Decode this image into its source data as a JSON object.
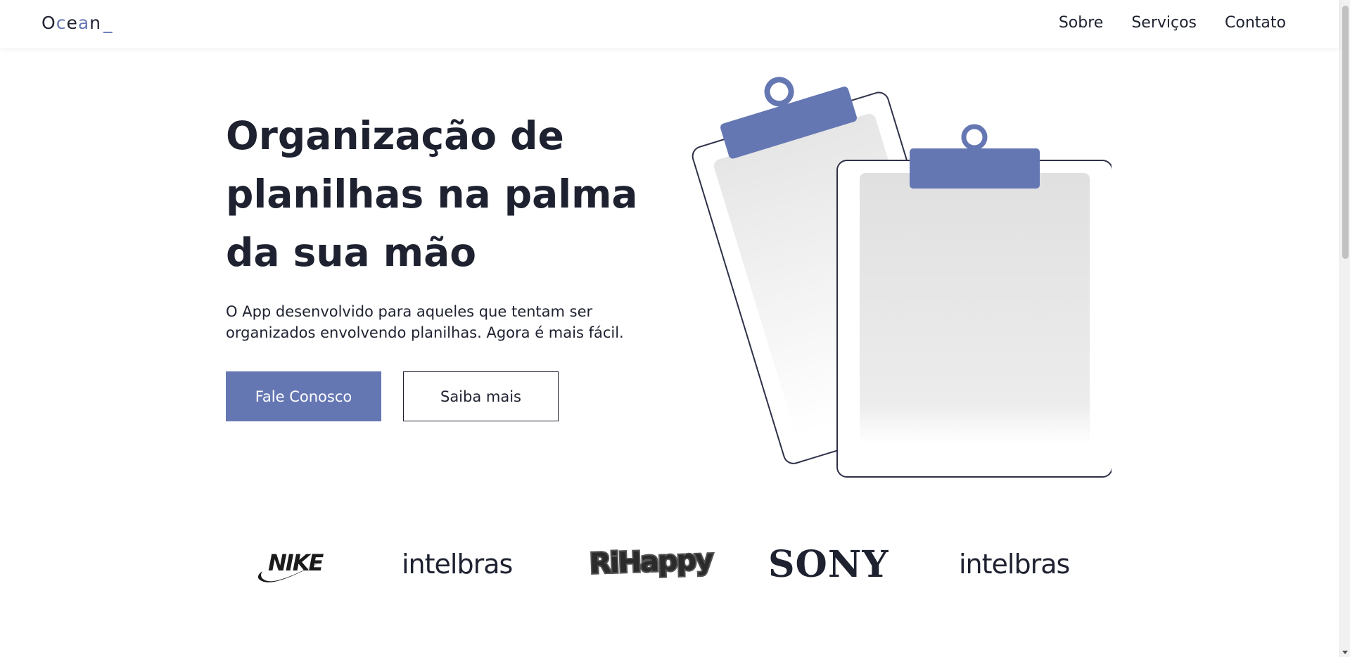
{
  "header": {
    "logo": {
      "part1": "O",
      "part2": "c",
      "part3": "e",
      "part4": "a",
      "part5": "n",
      "cursor": "_"
    },
    "nav": [
      {
        "label": "Sobre"
      },
      {
        "label": "Serviços"
      },
      {
        "label": "Contato"
      }
    ]
  },
  "hero": {
    "title": "Organização de planilhas na palma da sua mão",
    "description": "O App desenvolvido para aqueles que tentam ser organizados envolvendo planilhas. Agora é mais fácil.",
    "primary_button": "Fale Conosco",
    "secondary_button": "Saiba mais"
  },
  "brands": [
    {
      "name": "NIKE"
    },
    {
      "name": "intelbras"
    },
    {
      "name": "RiHappy"
    },
    {
      "name": "SONY"
    },
    {
      "name": "intelbras"
    }
  ],
  "colors": {
    "accent": "#6577b3",
    "text": "#1e2230",
    "background": "#ffffff"
  }
}
